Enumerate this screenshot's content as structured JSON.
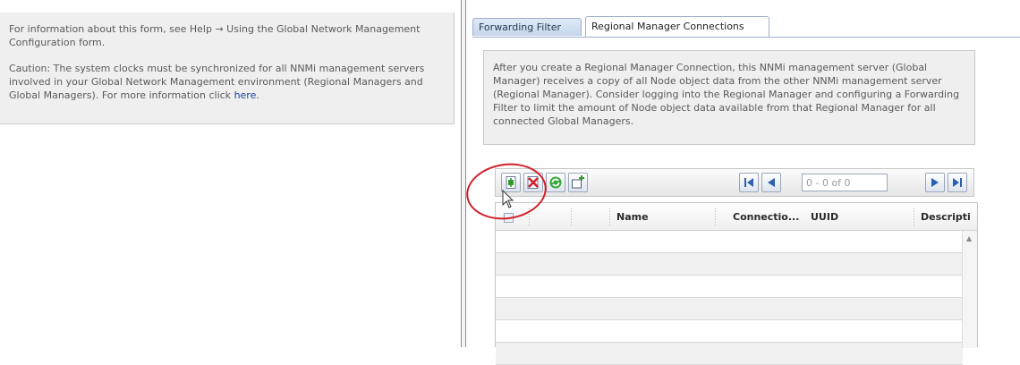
{
  "info_panel": {
    "line1": "For information about this form, see Help → Using the Global Network Management Configuration form.",
    "caution": "Caution: The system clocks must be synchronized for all NNMi management servers involved in your Global Network Management environment (Regional Managers and Global Managers). For more information click ",
    "link": "here",
    "link_suffix": "."
  },
  "tabs": [
    {
      "label": "Forwarding Filter",
      "active": false
    },
    {
      "label": "Regional Manager Connections",
      "active": true
    }
  ],
  "description": "After you create a Regional Manager Connection, this NNMi management server (Global Manager) receives a copy of all Node object data from the other NNMi management server (Regional Manager). Consider logging into the Regional Manager and configuring a Forwarding Filter to limit the amount of Node object data available from that Regional Manager for all connected Global Managers.",
  "toolbar": {
    "buttons": [
      {
        "name": "new-icon"
      },
      {
        "name": "delete-icon"
      },
      {
        "name": "refresh-icon"
      },
      {
        "name": "add-attribute-icon"
      }
    ],
    "pagination": {
      "value": "0 - 0 of 0"
    }
  },
  "table": {
    "columns": [
      "Name",
      "Connectio...",
      "UUID",
      "Descripti"
    ],
    "rows": []
  },
  "colors": {
    "annotation": "#d21f2b",
    "tab_border": "#9eb0c8",
    "panel_bg": "#efefef"
  }
}
